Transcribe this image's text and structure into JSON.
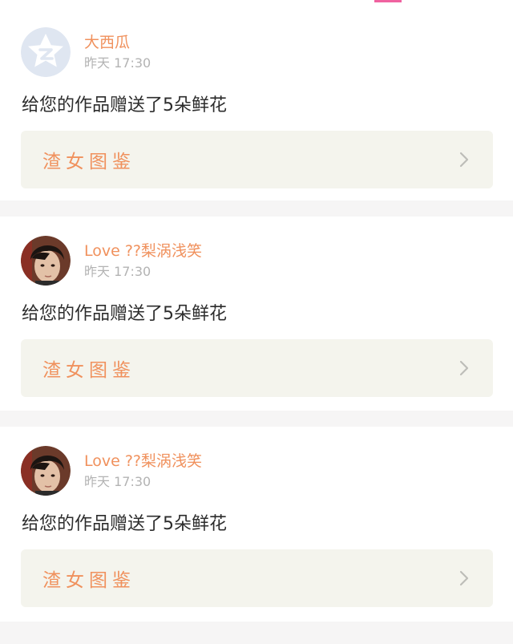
{
  "notifications": [
    {
      "username": "大西瓜",
      "time": "昨天 17:30",
      "message": "给您的作品赠送了5朵鲜花",
      "work_title": "渣女图鉴",
      "avatar": "default-star-avatar"
    },
    {
      "username": "Love ??梨涡浅笑",
      "time": "昨天 17:30",
      "message": "给您的作品赠送了5朵鲜花",
      "work_title": "渣女图鉴",
      "avatar": "user-photo-avatar"
    },
    {
      "username": "Love ??梨涡浅笑",
      "time": "昨天 17:30",
      "message": "给您的作品赠送了5朵鲜花",
      "work_title": "渣女图鉴",
      "avatar": "user-photo-avatar"
    }
  ],
  "colors": {
    "accent": "#f0915d",
    "background": "#f6f5f5",
    "link_bg": "#f4f4ed",
    "text": "#2c2c2c",
    "muted": "#b3b3b3"
  }
}
